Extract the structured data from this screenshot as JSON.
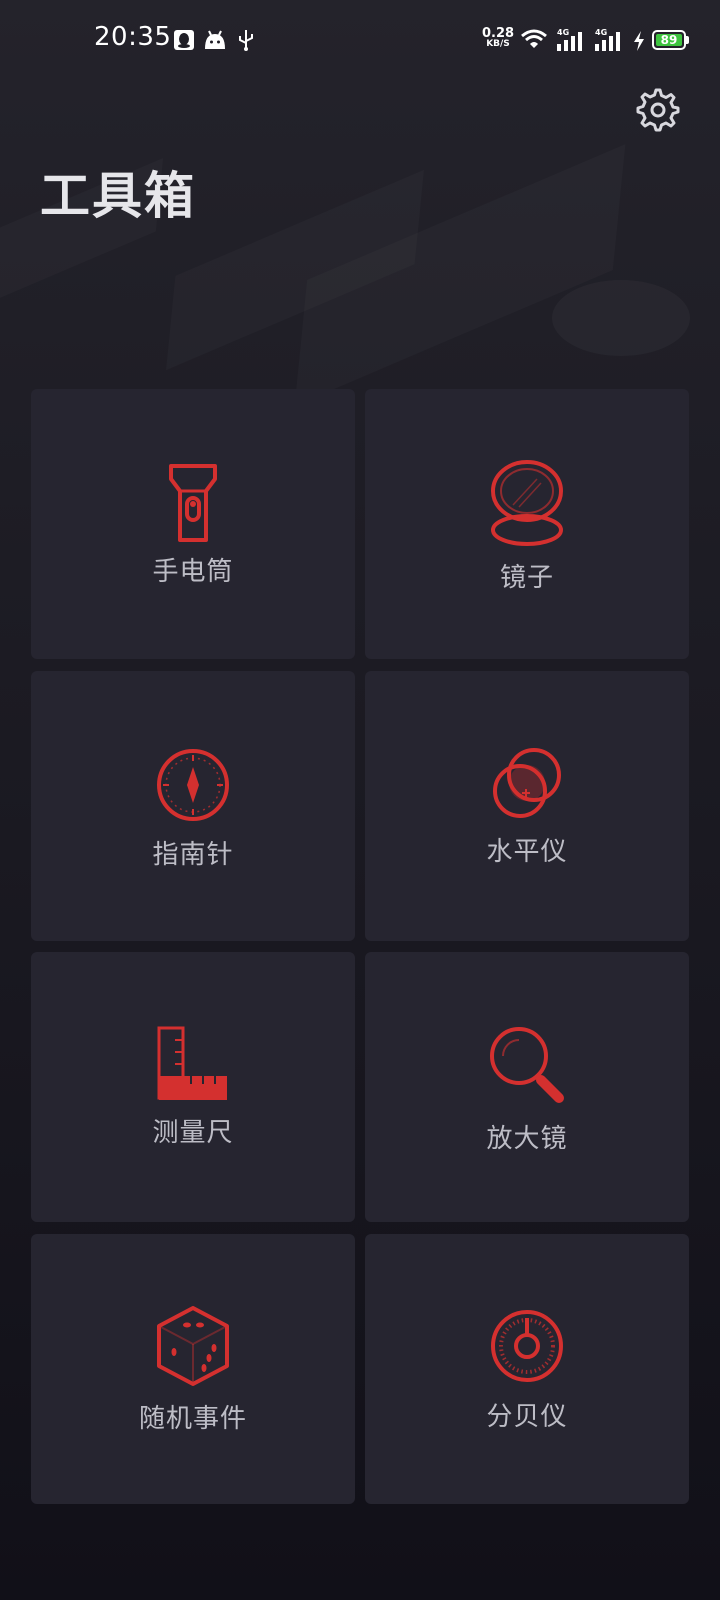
{
  "status_bar": {
    "time": "20:35",
    "net_speed_value": "0.28",
    "net_speed_unit": "KB/S",
    "sim1_label": "4G",
    "sim2_label": "4G",
    "battery_level": "89",
    "icons": [
      "qq-icon",
      "android-icon",
      "usb-icon",
      "wifi-icon",
      "signal-icon",
      "signal-icon",
      "charging-icon",
      "battery-icon"
    ]
  },
  "header": {
    "title": "工具箱",
    "settings_icon": "gear-icon"
  },
  "tools": [
    {
      "label": "手电筒",
      "icon": "flashlight-icon"
    },
    {
      "label": "镜子",
      "icon": "mirror-icon"
    },
    {
      "label": "指南针",
      "icon": "compass-icon"
    },
    {
      "label": "水平仪",
      "icon": "level-icon"
    },
    {
      "label": "测量尺",
      "icon": "ruler-icon"
    },
    {
      "label": "放大镜",
      "icon": "magnifier-icon"
    },
    {
      "label": "随机事件",
      "icon": "dice-icon"
    },
    {
      "label": "分贝仪",
      "icon": "decibel-meter-icon"
    }
  ],
  "colors": {
    "accent": "#d4302f",
    "tile_bg": "#262530",
    "battery": "#3ec43f"
  }
}
